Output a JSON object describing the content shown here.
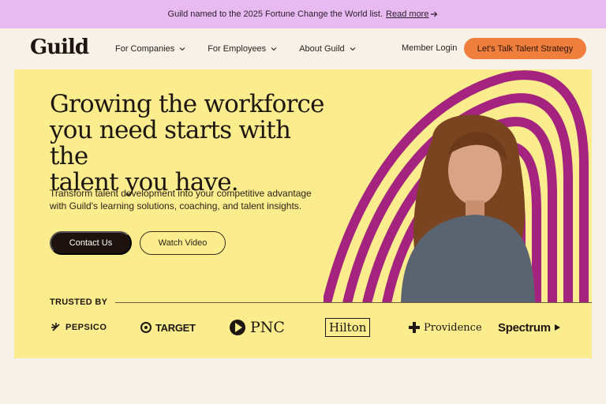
{
  "banner": {
    "text": "Guild named to the 2025 Fortune Change the World list.",
    "link": "Read more"
  },
  "nav": {
    "logo": "Guild",
    "items": [
      {
        "label": "For Companies"
      },
      {
        "label": "For Employees"
      },
      {
        "label": "About Guild"
      }
    ],
    "login": "Member Login",
    "cta": "Let's Talk Talent Strategy"
  },
  "hero": {
    "headline_lines": [
      "Growing the workforce",
      "you need starts with the",
      "talent you have."
    ],
    "subtext_lines": [
      "Transform talent development into your competitive advantage",
      "with Guild's learning solutions, coaching, and talent insights."
    ],
    "primary_button": "Contact Us",
    "secondary_button": "Watch Video"
  },
  "trusted": {
    "label": "TRUSTED BY",
    "logos": [
      "PEPSICO",
      "TARGET",
      "PNC",
      "Hilton",
      "Providence",
      "Spectrum"
    ]
  },
  "colors": {
    "banner_bg": "#e8baf2",
    "page_bg": "#f8f1e8",
    "hero_bg": "#fbed8e",
    "cta_orange": "#f07e3c",
    "wave_purple": "#a3237e"
  }
}
